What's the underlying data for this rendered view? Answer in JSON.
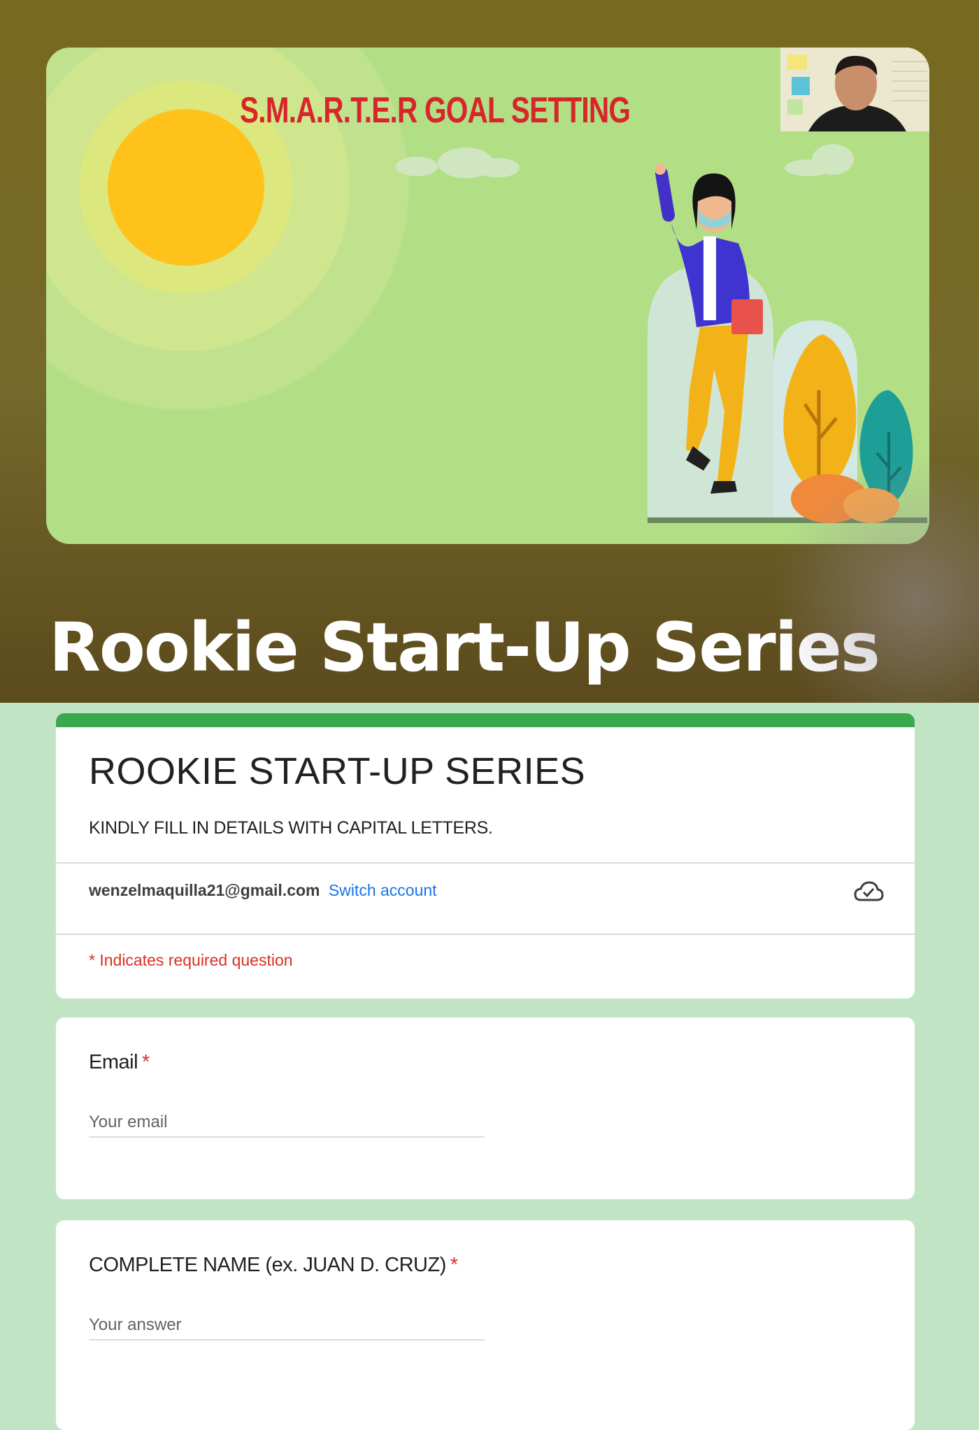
{
  "banner": {
    "slide_title": "S.M.A.R.T.E.R GOAL SETTING",
    "series_title": "Rookie Start-Up Series"
  },
  "form": {
    "title": "ROOKIE START-UP SERIES",
    "description": "KINDLY FILL IN DETAILS WITH CAPITAL LETTERS.",
    "account_email": "wenzelmaquilla21@gmail.com",
    "switch_account_label": "Switch account",
    "required_note": "* Indicates required question",
    "accent_color": "#3aa94e",
    "questions": [
      {
        "label": "Email",
        "required_mark": "*",
        "placeholder": "Your email",
        "value": ""
      },
      {
        "label": "COMPLETE NAME (ex. JUAN D. CRUZ)",
        "required_mark": "*",
        "placeholder": "Your answer",
        "value": ""
      }
    ]
  },
  "icons": {
    "save_status": "cloud-check-icon"
  }
}
